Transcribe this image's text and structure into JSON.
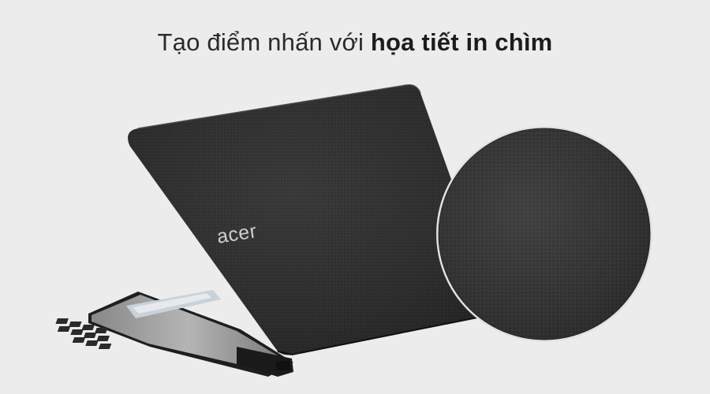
{
  "headline": {
    "normal": "Tạo điểm nhấn với ",
    "bold": "họa tiết in chìm"
  },
  "product": {
    "brand_logo": "acer",
    "description": "Laptop lid with embossed texture and zoomed texture detail circle"
  },
  "colors": {
    "background": "#ececec",
    "lid": "#2b2b2b",
    "texture_circle": "#363636",
    "logo": "#cfcfcf"
  }
}
